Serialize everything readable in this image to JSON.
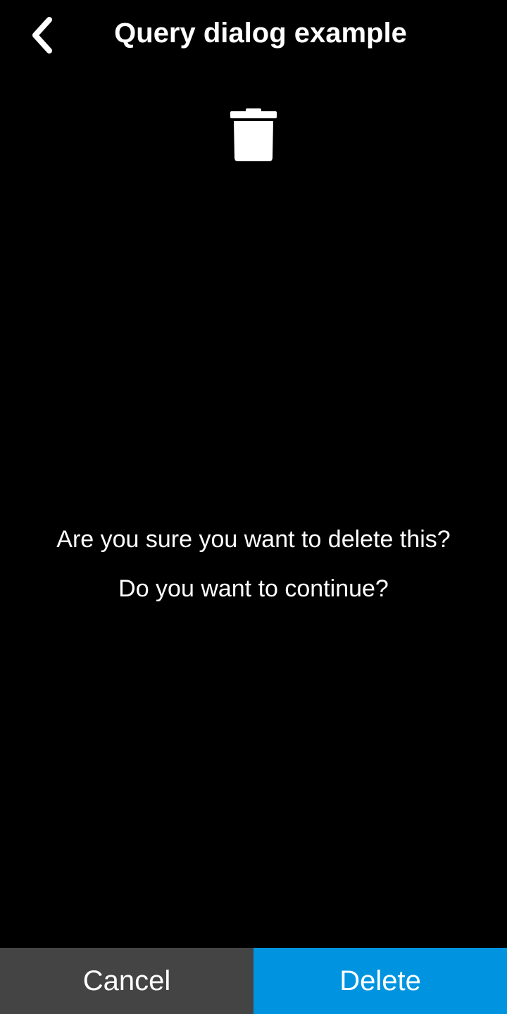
{
  "header": {
    "title": "Query dialog example",
    "back_icon": "chevron-left-icon"
  },
  "dialog": {
    "icon": "trash-icon",
    "message_line1": "Are you sure you want to delete this?",
    "message_line2": "Do you want to continue?"
  },
  "actions": {
    "cancel_label": "Cancel",
    "delete_label": "Delete"
  },
  "colors": {
    "background": "#000000",
    "text": "#ffffff",
    "cancel_bg": "#444444",
    "delete_bg": "#0094e0"
  }
}
